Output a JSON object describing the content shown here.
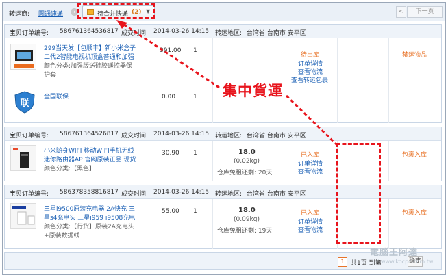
{
  "toolbar": {
    "carrier_label": "转运商:",
    "carrier_link": "圆通速递",
    "help_glyph": "?",
    "merge_label": "待合并快递",
    "merge_count": "(2)",
    "merge_caret": "▼",
    "pager_prev": "<",
    "pager_next": "下一页",
    "icons": {
      "help": "question-icon",
      "merge": "package-icon",
      "caret": "chevron-down-icon"
    }
  },
  "orders": [
    {
      "order_no_label": "宝贝订单编号:",
      "order_no": "586761364536817",
      "time_label": "成交时间:",
      "time": "2014-03-26 14:15",
      "dest_label": "转运地区:",
      "dest": "台湾省 台南市 安平区",
      "items": [
        {
          "name_l1": "299当天发【包顺丰】新小米盒子",
          "name_l2": "二代2智能电视机顶盒普通和加强",
          "attr_l1": "颜色分类:加强版送硅胶遥控器保",
          "attr_l2": "护套",
          "price": "391.00",
          "qty": "1"
        },
        {
          "name_l1": "全国联保",
          "price": "0.00",
          "qty": "1"
        }
      ],
      "status": "待出库",
      "links": [
        "订单详情",
        "查看物流",
        "查看转运包裹"
      ],
      "action": "禁运物品"
    },
    {
      "order_no_label": "宝贝订单编号:",
      "order_no": "586761364526817",
      "time_label": "成交时间:",
      "time": "2014-03-26 14:15",
      "dest_label": "转运地区:",
      "dest": "台湾省 台南市 安平区",
      "items": [
        {
          "name_l1": "小米随身WIFI 移动WIFI手机无线",
          "name_l2": "迷你路由器AP 官网原装正品 现货",
          "attr_l1": "颜色分类:【黑色】",
          "price": "30.90",
          "qty": "1"
        }
      ],
      "fee": "18.0",
      "weight": "(0.02kg)",
      "free_storage": "仓库免租还剩: 20天",
      "status": "已入库",
      "links": [
        "订单详情",
        "查看物流"
      ],
      "action": "包裹入库"
    },
    {
      "order_no_label": "宝贝订单编号:",
      "order_no": "586378358816817",
      "time_label": "成交时间:",
      "time": "2014-03-26 14:15",
      "dest_label": "转运地区:",
      "dest": "台湾省 台南市 安平区",
      "items": [
        {
          "name_l1": "三星i9500原装充电器 2A快充 三",
          "name_l2": "星s4充电头 三星i959 i9508充电",
          "attr_l1": "颜色分类:【行货】原装2A充电头",
          "attr_l2": "+原装数据线",
          "price": "55.00",
          "qty": "1"
        }
      ],
      "fee": "18.0",
      "weight": "(0.09kg)",
      "free_storage": "仓库免租还剩: 19天",
      "status": "已入库",
      "links": [
        "订单详情",
        "查看物流"
      ],
      "action": "包裹入库"
    }
  ],
  "footer": {
    "current_page": "1",
    "page_text": "共1页 到第",
    "go_label": "确定"
  },
  "annotation": {
    "text": "集中貨運",
    "color": "#e8141c"
  },
  "watermark": {
    "text": "電腦王阿達",
    "url": "www.kocpc.com.tw"
  },
  "colors": {
    "link": "#1a5fb4",
    "status": "#e8742a",
    "header_bg": "#eef3f9"
  }
}
